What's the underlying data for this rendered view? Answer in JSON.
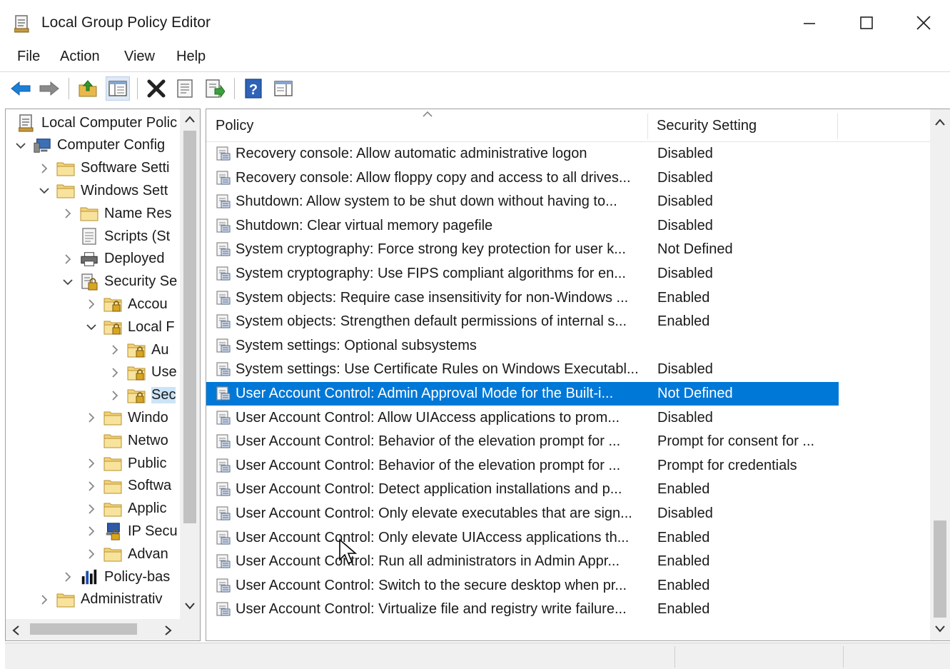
{
  "window": {
    "title": "Local Group Policy Editor",
    "controls": [
      "minimize",
      "maximize",
      "close"
    ]
  },
  "menu": [
    "File",
    "Action",
    "View",
    "Help"
  ],
  "toolbar": {
    "icons": [
      "back-arrow-icon",
      "forward-arrow-icon",
      "up-folder-icon",
      "show-hide-tree-icon",
      "delete-icon",
      "properties-icon",
      "export-list-icon",
      "help-icon",
      "show-hide-action-pane-icon"
    ],
    "colors": {
      "arrow": "#1c7fd6",
      "delete": "#222222",
      "help": "#2e63b8"
    }
  },
  "tree": {
    "nodes": [
      {
        "label": "Local Computer Polic",
        "depth": 0,
        "chevron": "none",
        "icon": "policy-doc-icon"
      },
      {
        "label": "Computer Config",
        "depth": 0,
        "chevron": "down",
        "icon": "computer-icon"
      },
      {
        "label": "Software Setti",
        "depth": 1,
        "chevron": "right",
        "icon": "folder-icon"
      },
      {
        "label": "Windows Sett",
        "depth": 1,
        "chevron": "down",
        "icon": "folder-icon"
      },
      {
        "label": "Name Res",
        "depth": 2,
        "chevron": "right",
        "icon": "folder-icon"
      },
      {
        "label": "Scripts (St",
        "depth": 2,
        "chevron": "none",
        "icon": "script-icon"
      },
      {
        "label": "Deployed",
        "depth": 2,
        "chevron": "right",
        "icon": "printer-icon"
      },
      {
        "label": "Security Se",
        "depth": 2,
        "chevron": "down",
        "icon": "security-icon"
      },
      {
        "label": "Accou",
        "depth": 3,
        "chevron": "right",
        "icon": "lock-folder-icon"
      },
      {
        "label": "Local F",
        "depth": 3,
        "chevron": "down",
        "icon": "lock-folder-icon"
      },
      {
        "label": "Au",
        "depth": 4,
        "chevron": "right",
        "icon": "lock-folder-icon"
      },
      {
        "label": "Use",
        "depth": 4,
        "chevron": "right",
        "icon": "lock-folder-icon"
      },
      {
        "label": "Sec",
        "depth": 4,
        "chevron": "right",
        "icon": "lock-folder-icon",
        "selected": true
      },
      {
        "label": "Windo",
        "depth": 3,
        "chevron": "right",
        "icon": "folder-icon"
      },
      {
        "label": "Netwo",
        "depth": 3,
        "chevron": "none",
        "icon": "folder-icon"
      },
      {
        "label": "Public",
        "depth": 3,
        "chevron": "right",
        "icon": "folder-icon"
      },
      {
        "label": "Softwa",
        "depth": 3,
        "chevron": "right",
        "icon": "folder-icon"
      },
      {
        "label": "Applic",
        "depth": 3,
        "chevron": "right",
        "icon": "folder-icon"
      },
      {
        "label": "IP Secu",
        "depth": 3,
        "chevron": "right",
        "icon": "ip-security-icon"
      },
      {
        "label": "Advan",
        "depth": 3,
        "chevron": "right",
        "icon": "folder-icon"
      },
      {
        "label": "Policy-bas",
        "depth": 2,
        "chevron": "right",
        "icon": "chart-icon"
      },
      {
        "label": "Administrativ",
        "depth": 1,
        "chevron": "right",
        "icon": "folder-icon"
      }
    ]
  },
  "list": {
    "headers": {
      "policy": "Policy",
      "setting": "Security Setting"
    },
    "rows": [
      {
        "policy": "Recovery console: Allow automatic administrative logon",
        "setting": "Disabled"
      },
      {
        "policy": "Recovery console: Allow floppy copy and access to all drives...",
        "setting": "Disabled"
      },
      {
        "policy": "Shutdown: Allow system to be shut down without having to...",
        "setting": "Disabled"
      },
      {
        "policy": "Shutdown: Clear virtual memory pagefile",
        "setting": "Disabled"
      },
      {
        "policy": "System cryptography: Force strong key protection for user k...",
        "setting": "Not Defined"
      },
      {
        "policy": "System cryptography: Use FIPS compliant algorithms for en...",
        "setting": "Disabled"
      },
      {
        "policy": "System objects: Require case insensitivity for non-Windows ...",
        "setting": "Enabled"
      },
      {
        "policy": "System objects: Strengthen default permissions of internal s...",
        "setting": "Enabled"
      },
      {
        "policy": "System settings: Optional subsystems",
        "setting": ""
      },
      {
        "policy": "System settings: Use Certificate Rules on Windows Executabl...",
        "setting": "Disabled"
      },
      {
        "policy": "User Account Control: Admin Approval Mode for the Built-i...",
        "setting": "Not Defined",
        "selected": true
      },
      {
        "policy": "User Account Control: Allow UIAccess applications to prom...",
        "setting": "Disabled"
      },
      {
        "policy": "User Account Control: Behavior of the elevation prompt for ...",
        "setting": "Prompt for consent for ..."
      },
      {
        "policy": "User Account Control: Behavior of the elevation prompt for ...",
        "setting": "Prompt for credentials"
      },
      {
        "policy": "User Account Control: Detect application installations and p...",
        "setting": "Enabled"
      },
      {
        "policy": "User Account Control: Only elevate executables that are sign...",
        "setting": "Disabled"
      },
      {
        "policy": "User Account Control: Only elevate UIAccess applications th...",
        "setting": "Enabled"
      },
      {
        "policy": "User Account Control: Run all administrators in Admin Appr...",
        "setting": "Enabled"
      },
      {
        "policy": "User Account Control: Switch to the secure desktop when pr...",
        "setting": "Enabled"
      },
      {
        "policy": "User Account Control: Virtualize file and registry write failure...",
        "setting": "Enabled"
      }
    ],
    "selected_color": "#0078d7"
  }
}
